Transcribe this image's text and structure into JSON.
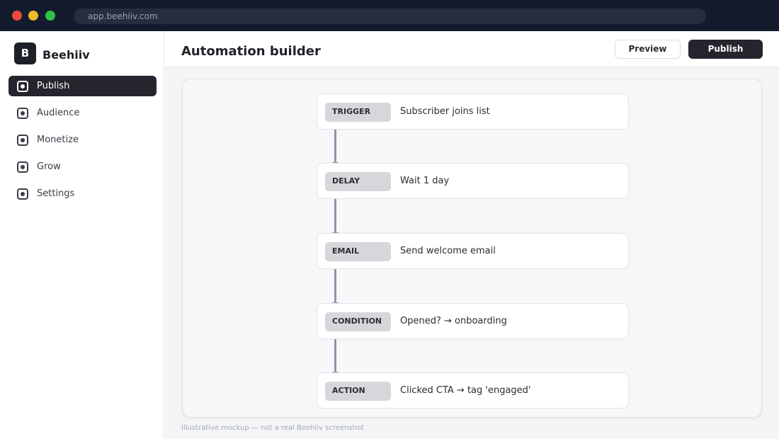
{
  "browser": {
    "url": "app.beehiiv.com"
  },
  "sidebar": {
    "logo_letter": "B",
    "brand": "Beehiiv",
    "items": [
      {
        "label": "Publish",
        "icon": "box-dot-icon",
        "active": true
      },
      {
        "label": "Audience",
        "icon": "box-dot-icon",
        "active": false
      },
      {
        "label": "Monetize",
        "icon": "box-dot-icon",
        "active": false
      },
      {
        "label": "Grow",
        "icon": "box-dot-icon",
        "active": false
      },
      {
        "label": "Settings",
        "icon": "box-dot-icon",
        "active": false
      }
    ]
  },
  "header": {
    "title": "Automation builder",
    "preview_label": "Preview",
    "publish_label": "Publish"
  },
  "flow": {
    "nodes": [
      {
        "type": "TRIGGER",
        "text": "Subscriber joins list"
      },
      {
        "type": "DELAY",
        "text": "Wait 1 day"
      },
      {
        "type": "EMAIL",
        "text": "Send welcome email"
      },
      {
        "type": "CONDITION",
        "text": "Opened? → onboarding"
      },
      {
        "type": "ACTION",
        "text": "Clicked CTA → tag 'engaged'"
      }
    ]
  },
  "footnote": "Illustrative mockup — not a real Beehiiv screenshot",
  "colors": {
    "chrome": "#141b2d",
    "accent_dark": "#24252d",
    "connector": "#8d96a8"
  }
}
